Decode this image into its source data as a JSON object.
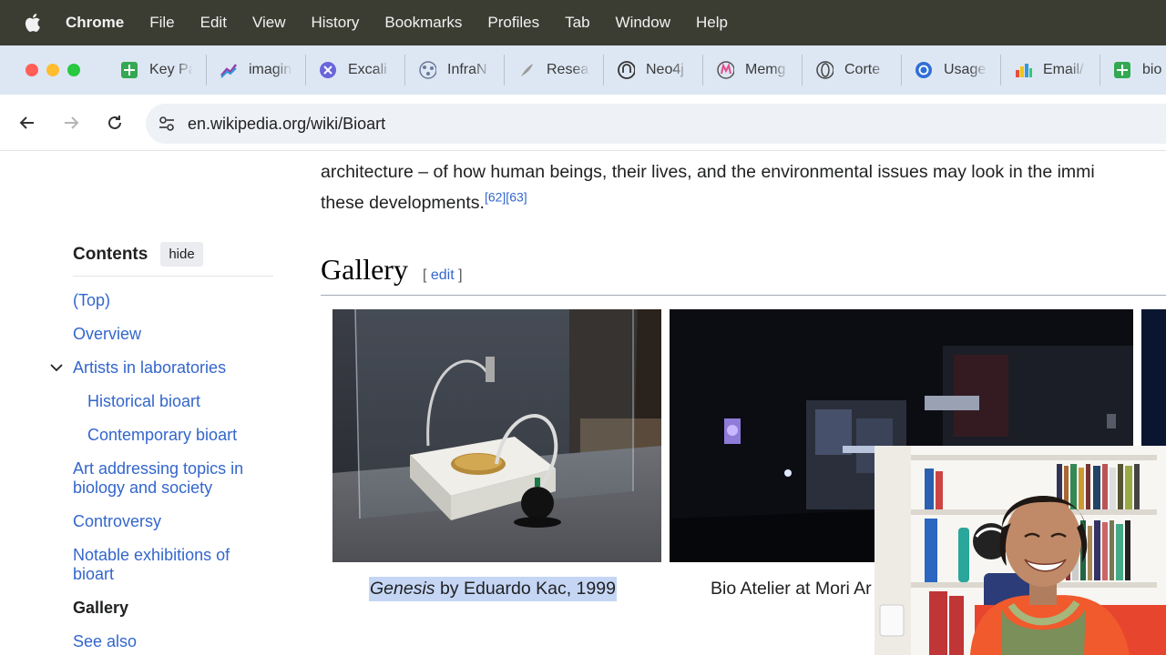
{
  "menubar": {
    "app_name": "Chrome",
    "items": [
      "File",
      "Edit",
      "View",
      "History",
      "Bookmarks",
      "Profiles",
      "Tab",
      "Window",
      "Help"
    ]
  },
  "tabs": [
    {
      "label": "Key Pa",
      "icon": "sheets-plus-icon"
    },
    {
      "label": "imagin",
      "icon": "chart-trend-icon"
    },
    {
      "label": "Excali",
      "icon": "excalidraw-icon"
    },
    {
      "label": "InfraN",
      "icon": "infranodus-icon"
    },
    {
      "label": "Resea",
      "icon": "feather-icon"
    },
    {
      "label": "Neo4j",
      "icon": "neo4j-icon"
    },
    {
      "label": "Memg",
      "icon": "memgraph-icon"
    },
    {
      "label": "Corte",
      "icon": "cortex-icon"
    },
    {
      "label": "Usage",
      "icon": "openai-icon"
    },
    {
      "label": "Email/",
      "icon": "paint-icon"
    },
    {
      "label": "bio",
      "icon": "sheets-plus-icon"
    }
  ],
  "toolbar": {
    "url": "en.wikipedia.org/wiki/Bioart"
  },
  "article": {
    "para_line1": "architecture – of how human beings, their lives, and the environmental issues may look in the immi",
    "para_line2": "these developments.",
    "para_refs": "[62][63]",
    "section_heading": "Gallery",
    "edit_open": "[ ",
    "edit_link": "edit",
    "edit_close": " ]",
    "caption1_italic": "Genesis",
    "caption1_rest": " by Eduardo Kac, 1999",
    "caption2": "Bio Atelier at Mori Ar"
  },
  "toc": {
    "title": "Contents",
    "hide_label": "hide",
    "items": [
      {
        "label": "(Top)"
      },
      {
        "label": "Overview"
      },
      {
        "label": "Artists in laboratories"
      },
      {
        "label": "Historical bioart"
      },
      {
        "label": "Contemporary bioart"
      },
      {
        "label": "Art addressing topics in biology and society"
      },
      {
        "label": "Controversy"
      },
      {
        "label": "Notable exhibitions of bioart"
      },
      {
        "label": "Gallery"
      },
      {
        "label": "See also"
      }
    ]
  },
  "colors": {
    "menubar_bg": "#3c3d32",
    "tabstrip_bg": "#dde7f3",
    "link": "#3366cc",
    "selection": "#c5d6f5"
  }
}
